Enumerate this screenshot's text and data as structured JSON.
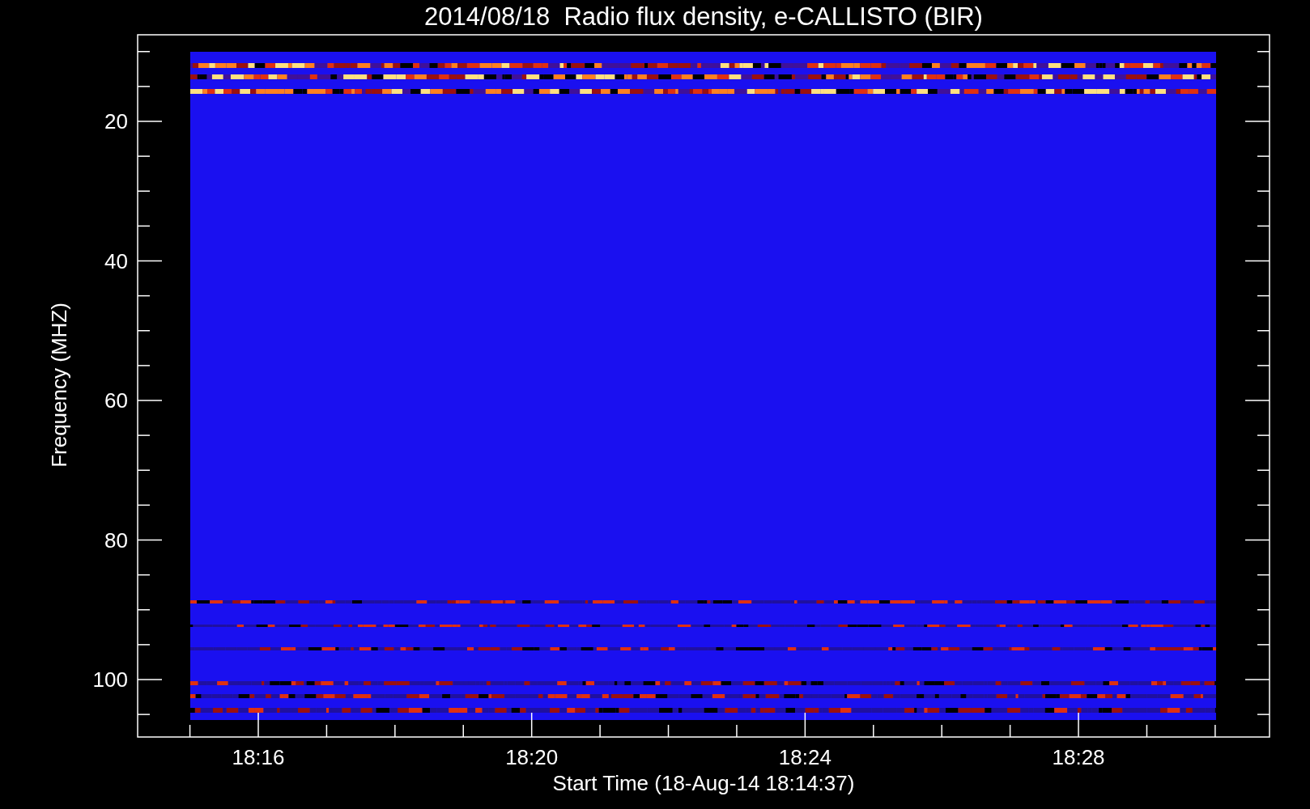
{
  "title": "2014/08/18  Radio flux density, e-CALLISTO (BIR)",
  "y_axis": {
    "label": "Frequency (MHZ)",
    "ticks": [
      "20",
      "40",
      "60",
      "80",
      "100"
    ]
  },
  "x_axis": {
    "label": "Start Time (18-Aug-14 18:14:37)",
    "ticks": [
      "18:16",
      "18:20",
      "18:24",
      "18:28"
    ]
  }
}
